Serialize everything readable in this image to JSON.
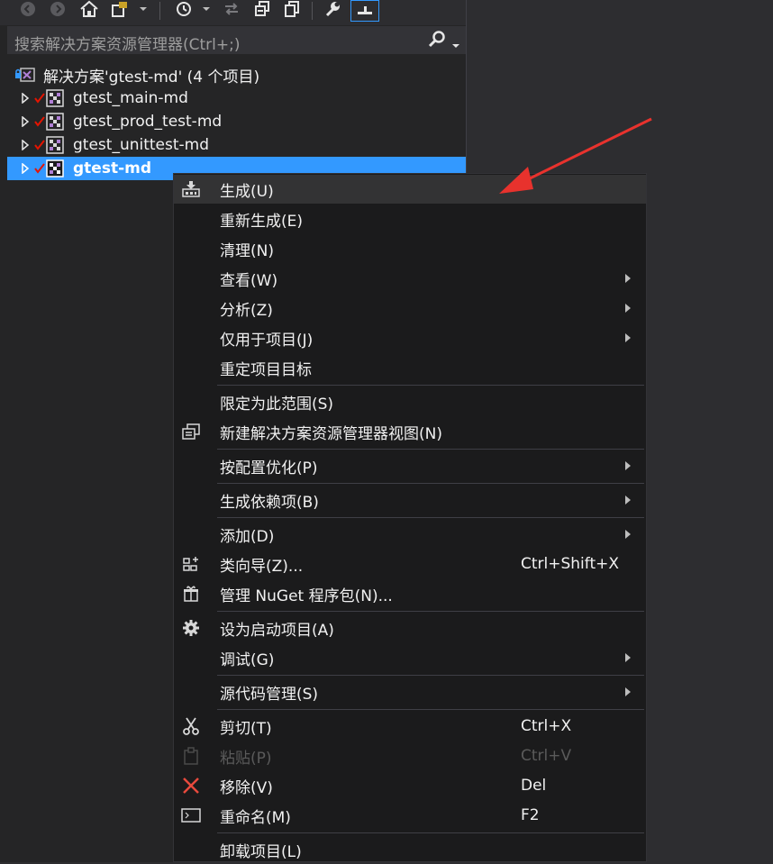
{
  "search": {
    "placeholder": "搜索解决方案资源管理器(Ctrl+;)"
  },
  "solution": {
    "label": "解决方案'gtest-md' (4 个项目)"
  },
  "projects": [
    {
      "label": "gtest_main-md"
    },
    {
      "label": "gtest_prod_test-md"
    },
    {
      "label": "gtest_unittest-md"
    },
    {
      "label": "gtest-md"
    }
  ],
  "menu": {
    "build": "生成(U)",
    "rebuild": "重新生成(E)",
    "clean": "清理(N)",
    "view": "查看(W)",
    "analyze": "分析(Z)",
    "project_only": "仅用于项目(J)",
    "retarget": "重定项目目标",
    "scope_to_this": "限定为此范围(S)",
    "new_view": "新建解决方案资源管理器视图(N)",
    "profile_guided": "按配置优化(P)",
    "build_dependencies": "生成依赖项(B)",
    "add": "添加(D)",
    "class_wizard": "类向导(Z)...",
    "class_wizard_shortcut": "Ctrl+Shift+X",
    "manage_nuget": "管理 NuGet 程序包(N)...",
    "set_startup": "设为启动项目(A)",
    "debug": "调试(G)",
    "source_control": "源代码管理(S)",
    "cut": "剪切(T)",
    "cut_shortcut": "Ctrl+X",
    "paste": "粘贴(P)",
    "paste_shortcut": "Ctrl+V",
    "remove": "移除(V)",
    "remove_shortcut": "Del",
    "rename": "重命名(M)",
    "rename_shortcut": "F2",
    "unload": "卸载项目(L)"
  },
  "colors": {
    "selection": "#3399ff",
    "annotation_arrow": "#e8322d",
    "check": "#e51400",
    "remove_icon": "#e84a3d"
  }
}
